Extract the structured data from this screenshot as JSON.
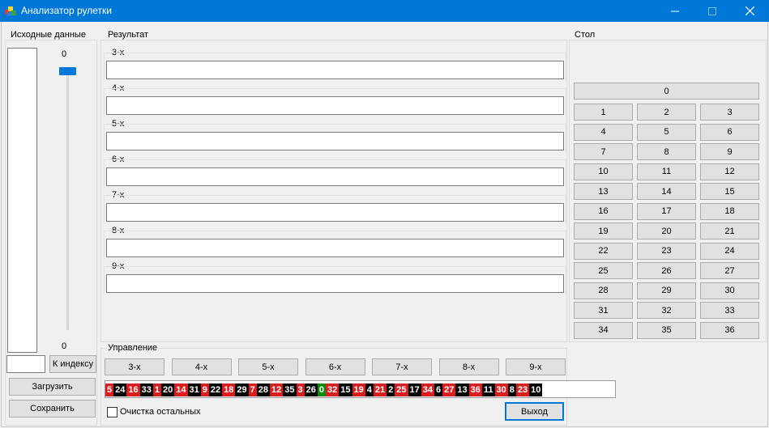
{
  "window": {
    "title": "Анализатор рулетки",
    "minimize": "—",
    "maximize": "☐",
    "close": "✕"
  },
  "source_panel": {
    "title": "Исходные данные",
    "trackbar_top": "0",
    "trackbar_bottom": "0",
    "index_input_value": "",
    "to_index_button": "К индексу",
    "load_button": "Загрузить",
    "save_button": "Сохранить"
  },
  "result_panel": {
    "title": "Результат",
    "rows": [
      {
        "label": "3-х",
        "value": ""
      },
      {
        "label": "4-х",
        "value": ""
      },
      {
        "label": "5-х",
        "value": ""
      },
      {
        "label": "6-х",
        "value": ""
      },
      {
        "label": "7-х",
        "value": ""
      },
      {
        "label": "8-х",
        "value": ""
      },
      {
        "label": "9-х",
        "value": ""
      }
    ]
  },
  "table_panel": {
    "title": "Стол",
    "zero": "0",
    "numbers": [
      "1",
      "2",
      "3",
      "4",
      "5",
      "6",
      "7",
      "8",
      "9",
      "10",
      "11",
      "12",
      "13",
      "14",
      "15",
      "16",
      "17",
      "18",
      "19",
      "20",
      "21",
      "22",
      "23",
      "24",
      "25",
      "26",
      "27",
      "28",
      "29",
      "30",
      "31",
      "32",
      "33",
      "34",
      "35",
      "36"
    ]
  },
  "control_panel": {
    "title": "Управление",
    "buttons": [
      "3-х",
      "4-х",
      "5-х",
      "6-х",
      "7-х",
      "8-х",
      "9-х"
    ],
    "clear_checkbox_label": "Очистка остальных",
    "clear_checked": false,
    "exit_button": "Выход"
  },
  "wheel_strip": {
    "numbers": [
      {
        "n": "5",
        "color": "red"
      },
      {
        "n": "24",
        "color": "black"
      },
      {
        "n": "16",
        "color": "red"
      },
      {
        "n": "33",
        "color": "black"
      },
      {
        "n": "1",
        "color": "red"
      },
      {
        "n": "20",
        "color": "black"
      },
      {
        "n": "14",
        "color": "red"
      },
      {
        "n": "31",
        "color": "black"
      },
      {
        "n": "9",
        "color": "red"
      },
      {
        "n": "22",
        "color": "black"
      },
      {
        "n": "18",
        "color": "red"
      },
      {
        "n": "29",
        "color": "black"
      },
      {
        "n": "7",
        "color": "red"
      },
      {
        "n": "28",
        "color": "black"
      },
      {
        "n": "12",
        "color": "red"
      },
      {
        "n": "35",
        "color": "black"
      },
      {
        "n": "3",
        "color": "red"
      },
      {
        "n": "26",
        "color": "black"
      },
      {
        "n": "0",
        "color": "green"
      },
      {
        "n": "32",
        "color": "red"
      },
      {
        "n": "15",
        "color": "black"
      },
      {
        "n": "19",
        "color": "red"
      },
      {
        "n": "4",
        "color": "black"
      },
      {
        "n": "21",
        "color": "red"
      },
      {
        "n": "2",
        "color": "black"
      },
      {
        "n": "25",
        "color": "red"
      },
      {
        "n": "17",
        "color": "black"
      },
      {
        "n": "34",
        "color": "red"
      },
      {
        "n": "6",
        "color": "black"
      },
      {
        "n": "27",
        "color": "red"
      },
      {
        "n": "13",
        "color": "black"
      },
      {
        "n": "36",
        "color": "red"
      },
      {
        "n": "11",
        "color": "black"
      },
      {
        "n": "30",
        "color": "red"
      },
      {
        "n": "8",
        "color": "black"
      },
      {
        "n": "23",
        "color": "red"
      },
      {
        "n": "10",
        "color": "black"
      }
    ],
    "colors": {
      "red": "#d81e1e",
      "black": "#000000",
      "green": "#0f8a0f"
    }
  },
  "colors": {
    "accent": "#0078d7",
    "titlebar_text": "#ffffff"
  },
  "icons": {
    "app": "roulette-cubes-icon"
  }
}
